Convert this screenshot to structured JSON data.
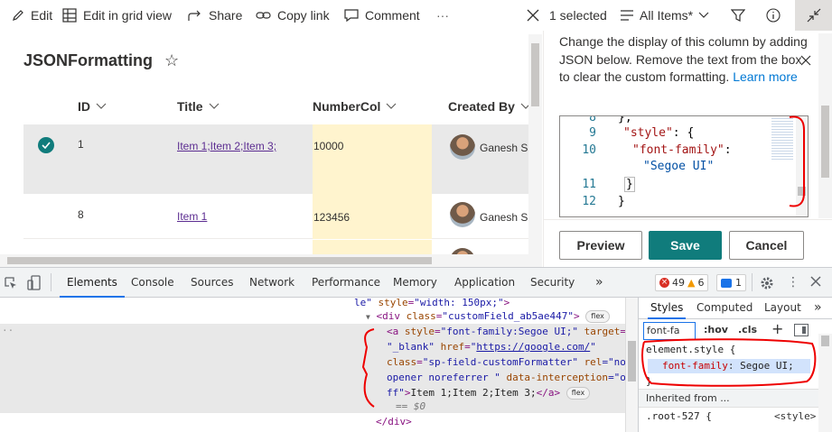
{
  "commandbar": {
    "edit": "Edit",
    "edit_grid": "Edit in grid view",
    "share": "Share",
    "copy_link": "Copy link",
    "comment": "Comment",
    "more": "···",
    "selected": "1 selected",
    "view": "All Items*"
  },
  "list": {
    "title": "JSONFormatting",
    "columns": [
      "ID",
      "Title",
      "NumberCol",
      "Created By"
    ],
    "rows": [
      {
        "id": "1",
        "title": "Item 1;Item 2;Item 3;",
        "number": "10000",
        "created_by": "Ganesh Sa",
        "selected": true
      },
      {
        "id": "8",
        "title": "Item 1",
        "number": "123456",
        "created_by": "Ganesh Sa",
        "selected": false
      }
    ]
  },
  "panel": {
    "description": "Change the display of this column by adding JSON below. Remove the text from the box to clear the custom formatting.",
    "learn_more": "Learn more",
    "code": {
      "line8_num": "8",
      "line8": "},",
      "line9_num": "9",
      "line9_key": "\"style\"",
      "line9_rest": ": {",
      "line10_num": "10",
      "line10_key": "\"font-family\"",
      "line10_rest": ":",
      "line10b": "\"Segoe UI\"",
      "line11_num": "11",
      "line11": "}",
      "line12_num": "12",
      "line12": "}"
    },
    "preview": "Preview",
    "save": "Save",
    "cancel": "Cancel"
  },
  "devtools": {
    "tabs": [
      "Elements",
      "Console",
      "Sources",
      "Network",
      "Performance",
      "Memory",
      "Application",
      "Security",
      "»"
    ],
    "errors": "49",
    "warnings": "6",
    "messages": "1",
    "dom": {
      "l1_a": "le\"",
      "l1_attr": "style",
      "l1_val": "\"width: 150px;\"",
      "l1_close": ">",
      "l2_open": "<div",
      "l2_attr": "class",
      "l2_val": "\"customField_ab5ae447\"",
      "l2_close": ">",
      "l3_open": "<a",
      "l3_attr1": "style",
      "l3_val1": "\"font-family:Segoe UI;\"",
      "l3_attr2": "target",
      "l3_eq": "=",
      "l4_val": "\"_blank\"",
      "l4_attr": "href",
      "l4_url": "https://google.com/",
      "l4_q": "\"",
      "l5_attr": "class",
      "l5_val": "\"sp-field-customFormatter\"",
      "l5_attr2": "rel",
      "l5_eq": "=\"no",
      "l6_val": "opener noreferrer \"",
      "l6_attr": "data-interception",
      "l6_eq": "=\"o",
      "l7_val": "ff\"",
      "l7_txt": "Item 1;Item 2;Item 3;",
      "l7_close": "</a>",
      "l8": "== $0",
      "l9": "</div>",
      "flex": "flex"
    },
    "styles": {
      "tabs": [
        "Styles",
        "Computed",
        "Layout",
        "»"
      ],
      "filter": "font-fa",
      "hov": ":hov",
      "cls": ".cls",
      "selector": "element.style {",
      "prop": "font-family",
      "value": "Segoe UI;",
      "close": "}",
      "inherited": "Inherited from ...",
      "root": ".root-527 {",
      "source": "<style>"
    }
  }
}
